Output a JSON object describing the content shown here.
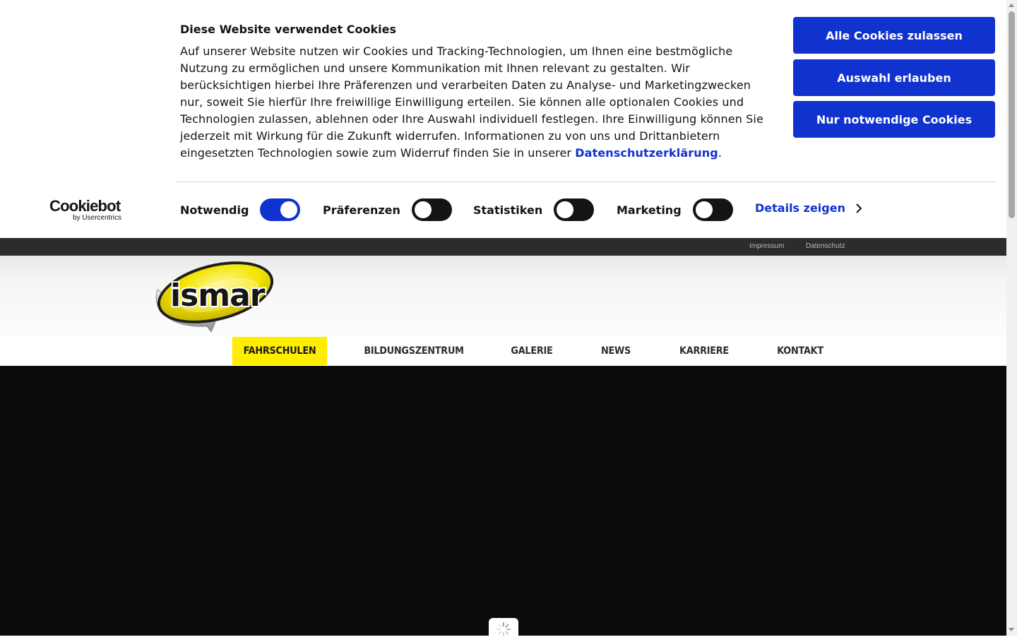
{
  "cookie_banner": {
    "title": "Diese Website verwendet Cookies",
    "text": "Auf unserer Website nutzen wir Cookies und Tracking-Technologien, um Ihnen eine bestmögliche Nutzung zu ermöglichen und unsere Kommunikation mit Ihnen relevant zu gestalten. Wir berücksichtigen hierbei Ihre Präferenzen und verarbeiten Daten zu Analyse- und Marketingzwecken nur, soweit Sie hierfür Ihre freiwillige Einwilligung erteilen. Sie können alle optionalen Cookies und Technologien zulassen, ablehnen oder Ihre Auswahl individuell festlegen. Ihre Einwilligung können Sie jederzeit mit Wirkung für die Zukunft widerrufen. Informationen zu von uns und Drittanbietern eingesetzten Technologien sowie zum Widerruf finden Sie in unserer ",
    "privacy_link": "Datenschutzerklärung",
    "text_end": ".",
    "buttons": {
      "allow_all": "Alle Cookies zulassen",
      "allow_selection": "Auswahl erlauben",
      "necessary_only": "Nur notwendige Cookies"
    },
    "brand": {
      "name": "Cookiebot",
      "sub": "by Usercentrics"
    },
    "toggles": [
      {
        "label": "Notwendig",
        "enabled": true
      },
      {
        "label": "Präferenzen",
        "enabled": false
      },
      {
        "label": "Statistiken",
        "enabled": false
      },
      {
        "label": "Marketing",
        "enabled": false
      }
    ],
    "details_link": "Details zeigen",
    "accent_color": "#1032cf"
  },
  "topbar": {
    "links": [
      "Impressum",
      "Datenschutz"
    ]
  },
  "header": {
    "logo_text": "ismar",
    "nav": [
      {
        "label": "FAHRSCHULEN",
        "active": true
      },
      {
        "label": "BILDUNGSZENTRUM",
        "active": false
      },
      {
        "label": "GALERIE",
        "active": false
      },
      {
        "label": "NEWS",
        "active": false
      },
      {
        "label": "KARRIERE",
        "active": false
      },
      {
        "label": "KONTAKT",
        "active": false
      }
    ],
    "active_color": "#ffee00"
  },
  "hero": {
    "loader_icon": "spinner-icon"
  }
}
